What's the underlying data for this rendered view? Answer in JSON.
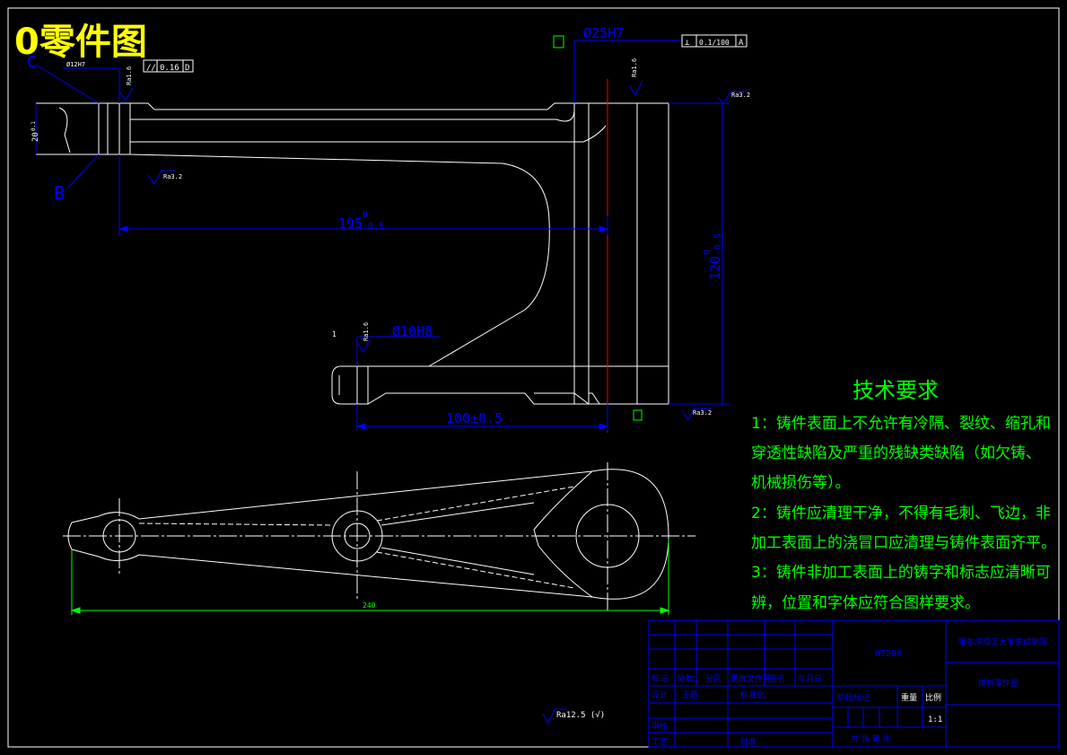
{
  "title": "0零件图",
  "colors": {
    "background": "#000000",
    "outline": "#ffffff",
    "dimension": "#0000ff",
    "title": "#ffff00",
    "notes": "#00ff00",
    "centerline": "#ff0000",
    "table": "#0000ff"
  },
  "top_view": {
    "datum_c": "C",
    "datum_b": "B",
    "hole_small_fit": "Ø12H7",
    "parallel_tol": "0.16",
    "parallel_datum": "D",
    "left_rough": "Ra1.6",
    "lower_rough": "Ra3.2",
    "hole_large": "Ø25H7",
    "perp_tol": "0.1/100",
    "perp_datum": "A",
    "mid_rough": "Ra1.6",
    "right_rough": "Ra3.2",
    "length_dim": "195",
    "length_tol_upper": "0",
    "length_tol_lower": "-0.5",
    "height_dim": "120",
    "height_tol_upper": "0",
    "height_tol_lower": "-0.5",
    "hole_bottom": "Ø10H8",
    "bottom_rough": "Ra1.6",
    "bottom_right_rough": "Ra3.2",
    "bottom_dim": "100±0.5",
    "thickness_dim": "20",
    "thickness_tol": "0.1",
    "gap_dim": "1"
  },
  "front_view": {
    "overall_length": "240"
  },
  "general_roughness": "Ra12.5 (√)",
  "tech_requirements": {
    "heading": "技术要求",
    "line1": "1：铸件表面上不允许有冷隔、裂纹、缩孔和",
    "line2": "穿透性缺陷及严重的残缺类缺陷（如欠铸、",
    "line3": "机械损伤等）。",
    "line4": "2：铸件应清理干净，不得有毛刺、飞边，非",
    "line5": "加工表面上的浇冒口应清理与铸件表面齐平。",
    "line6": "3：铸件非加工表面上的铸字和标志应清晰可",
    "line7": "辨，位置和字体应符合图样要求。"
  },
  "title_block": {
    "material": "HT200",
    "school": "哈尔滨理工大学荣成学院",
    "drawing_name": "拨杆零件图",
    "h_mark": "标记",
    "h_count": "处数",
    "h_zone": "分区",
    "h_docno": "更改文件号",
    "h_sign": "签名",
    "h_date": "年月日",
    "designer_label": "设计",
    "designer": "王超",
    "standard_label": "标准化",
    "stage_label": "阶段标记",
    "weight_label": "重量",
    "scale_label": "比例",
    "scale": "1:1",
    "review_label": "审核",
    "process_label": "工艺",
    "approve_label": "批准",
    "sheets": "共   张   第   张"
  }
}
